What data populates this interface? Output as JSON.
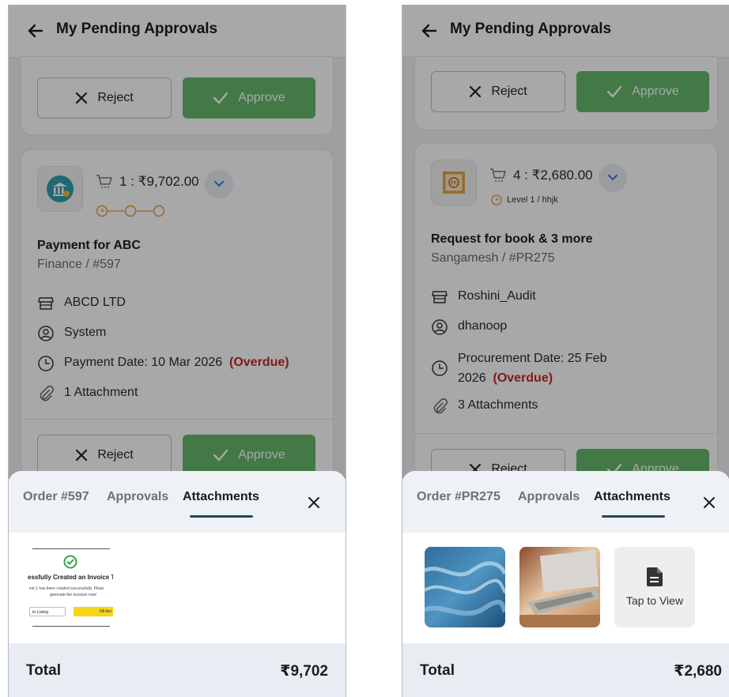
{
  "colors": {
    "approve": "#67b86c",
    "overdue": "#c0282b",
    "tab_indicator": "#24485a",
    "sheet_tabs_bg": "#eef2f6",
    "total_bg": "#e8edf4",
    "level_icon": "#e39a3b"
  },
  "left": {
    "header": {
      "title": "My Pending Approvals"
    },
    "prev_card": {
      "reject_label": "Reject",
      "approve_label": "Approve"
    },
    "card": {
      "logo_icon": "bank-icon",
      "cart_text": "1 : ₹9,702.00",
      "title": "Payment for ABC",
      "subtitle": "Finance / #597",
      "vendor": "ABCD LTD",
      "user": "System",
      "date_text": "Payment Date: 10 Mar 2026",
      "overdue": "(Overdue)",
      "attachments": "1 Attachment",
      "reject_label": "Reject",
      "approve_label": "Approve"
    },
    "sheet": {
      "tabs": [
        "Order #597",
        "Approvals",
        "Attachments"
      ],
      "active_tab": "Attachments",
      "thumb": {
        "heading": "essfully Created an Invoice Ten",
        "line1": "est 1 has been created successfully. Pleas",
        "line2": "generate the invoices now!",
        "btn_left": "to Listing",
        "btn_right": "Fill Am"
      },
      "total_label": "Total",
      "total_amount": "₹9,702"
    }
  },
  "right": {
    "header": {
      "title": "My Pending Approvals"
    },
    "prev_card": {
      "reject_label": "Reject",
      "approve_label": "Approve"
    },
    "card": {
      "logo_icon": "document-stamp-icon",
      "cart_text": "4 : ₹2,680.00",
      "level": "Level 1 / hhjk",
      "title": "Request for book & 3 more",
      "subtitle": "Sangamesh / #PR275",
      "vendor": "Roshini_Audit",
      "user": "dhanoop",
      "date_line1": "Procurement Date: 25 Feb",
      "date_line2": "2026",
      "overdue": "(Overdue)",
      "attachments": "3 Attachments",
      "reject_label": "Reject",
      "approve_label": "Approve"
    },
    "sheet": {
      "tabs": [
        "Order #PR275",
        "Approvals",
        "Attachments"
      ],
      "active_tab": "Attachments",
      "attachments": [
        "ocean-photo",
        "laptop-photo",
        "document-icon"
      ],
      "tap_to_view": "Tap to View",
      "total_label": "Total",
      "total_amount": "₹2,680"
    }
  }
}
